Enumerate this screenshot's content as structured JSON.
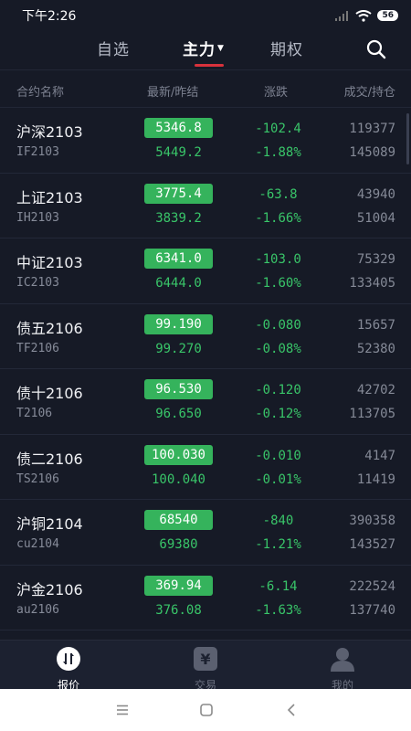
{
  "status": {
    "time": "下午2:26",
    "battery": "56"
  },
  "tabs": [
    {
      "label": "自选"
    },
    {
      "label": "主力"
    },
    {
      "label": "期权"
    }
  ],
  "columns": {
    "name": "合约名称",
    "price": "最新/昨结",
    "change": "涨跌",
    "volume": "成交/持仓"
  },
  "rows": [
    {
      "name": "沪深2103",
      "code": "IF2103",
      "price": "5346.8",
      "prev": "5449.2",
      "chg": "-102.4",
      "pct": "-1.88%",
      "vol": "119377",
      "oi": "145089"
    },
    {
      "name": "上证2103",
      "code": "IH2103",
      "price": "3775.4",
      "prev": "3839.2",
      "chg": "-63.8",
      "pct": "-1.66%",
      "vol": "43940",
      "oi": "51004"
    },
    {
      "name": "中证2103",
      "code": "IC2103",
      "price": "6341.0",
      "prev": "6444.0",
      "chg": "-103.0",
      "pct": "-1.60%",
      "vol": "75329",
      "oi": "133405"
    },
    {
      "name": "债五2106",
      "code": "TF2106",
      "price": "99.190",
      "prev": "99.270",
      "chg": "-0.080",
      "pct": "-0.08%",
      "vol": "15657",
      "oi": "52380"
    },
    {
      "name": "债十2106",
      "code": "T2106",
      "price": "96.530",
      "prev": "96.650",
      "chg": "-0.120",
      "pct": "-0.12%",
      "vol": "42702",
      "oi": "113705"
    },
    {
      "name": "债二2106",
      "code": "TS2106",
      "price": "100.030",
      "prev": "100.040",
      "chg": "-0.010",
      "pct": "-0.01%",
      "vol": "4147",
      "oi": "11419"
    },
    {
      "name": "沪铜2104",
      "code": "cu2104",
      "price": "68540",
      "prev": "69380",
      "chg": "-840",
      "pct": "-1.21%",
      "vol": "390358",
      "oi": "143527"
    },
    {
      "name": "沪金2106",
      "code": "au2106",
      "price": "369.94",
      "prev": "376.08",
      "chg": "-6.14",
      "pct": "-1.63%",
      "vol": "222524",
      "oi": "137740"
    }
  ],
  "bottom_nav": [
    {
      "label": "报价",
      "icon": "quote-icon"
    },
    {
      "label": "交易",
      "icon": "yen-icon"
    },
    {
      "label": "我的",
      "icon": "user-icon"
    }
  ],
  "colors": {
    "down": "#39c569",
    "down_chip": "#35b35c",
    "accent": "#d8323c",
    "bg": "#161a26"
  }
}
